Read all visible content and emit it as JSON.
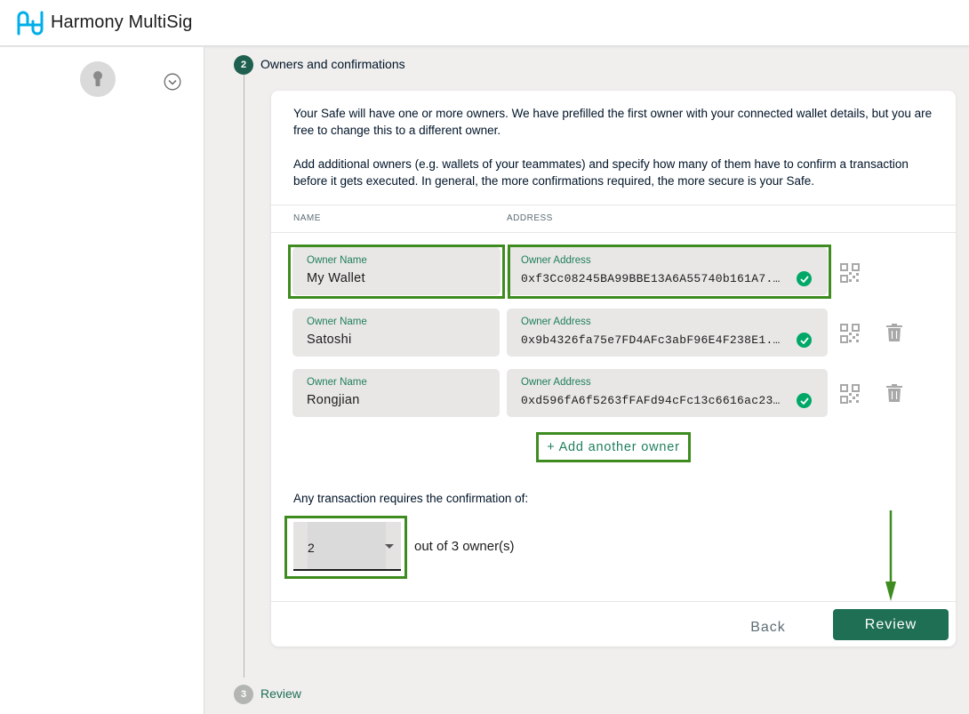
{
  "header": {
    "brand": "Harmony MultiSig"
  },
  "steps": {
    "current": {
      "number": "2",
      "label": "Owners and confirmations"
    },
    "next": {
      "number": "3",
      "label": "Review"
    }
  },
  "intro": {
    "p1": "Your Safe will have one or more owners. We have prefilled the first owner with your connected wallet details, but you are free to change this to a different owner.",
    "p2": "Add additional owners (e.g. wallets of your teammates) and specify how many of them have to confirm a transaction before it gets executed. In general, the more confirmations required, the more secure is your Safe."
  },
  "columns": {
    "name": "NAME",
    "address": "ADDRESS"
  },
  "owners": [
    {
      "name_label": "Owner Name",
      "name": "My Wallet",
      "address_label": "Owner Address",
      "address": "0xf3Cc08245BA99BBE13A6A55740b161A7...",
      "valid": true
    },
    {
      "name_label": "Owner Name",
      "name": "Satoshi",
      "address_label": "Owner Address",
      "address": "0x9b4326fa75e7FD4AFc3abF96E4F238E1...",
      "valid": true
    },
    {
      "name_label": "Owner Name",
      "name": "Rongjian",
      "address_label": "Owner Address",
      "address": "0xd596fA6f5263fFAFd94cFc13c6616ac23...",
      "valid": true
    }
  ],
  "add_owner_label": "+ Add another owner",
  "confirmation": {
    "prompt": "Any transaction requires the confirmation of:",
    "threshold": "2",
    "suffix": "out of 3 owner(s)"
  },
  "actions": {
    "back": "Back",
    "review": "Review"
  },
  "colors": {
    "accent": "#1f6f54",
    "highlight": "#3e8c20",
    "valid": "#00a868"
  }
}
